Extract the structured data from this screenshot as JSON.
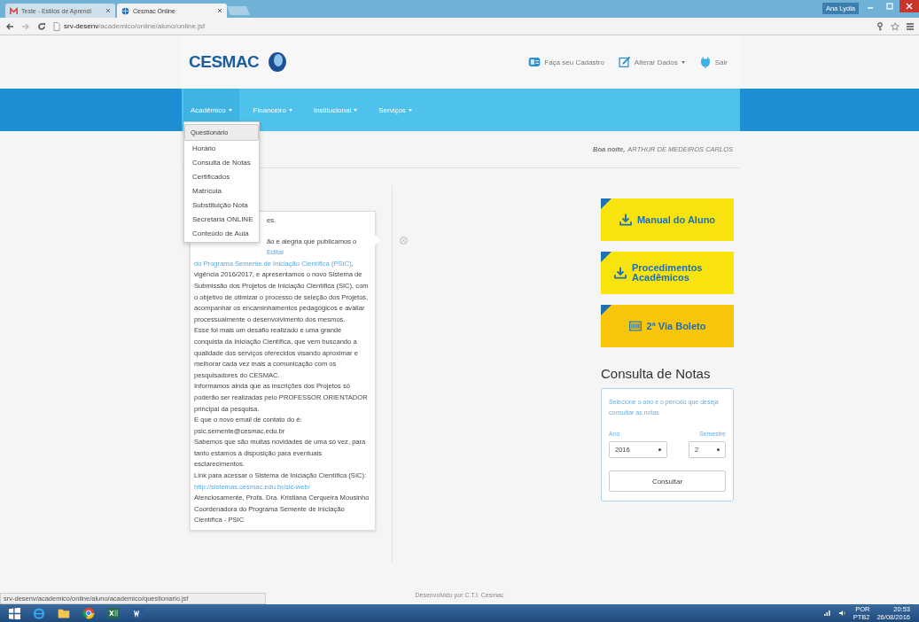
{
  "browser": {
    "tabs": [
      {
        "title": "Teste - Estilos de Aprendi",
        "kind": "mail",
        "selected": false
      },
      {
        "title": "Cesmac Online",
        "kind": "globe",
        "selected": true
      }
    ],
    "profile": "Ana Lydia",
    "address": {
      "host": "srv-desenv",
      "path": "/academico/online/aluno/online.jsf"
    }
  },
  "header": {
    "logo": "CESMAC",
    "links": [
      {
        "label": "Faça seu Cadastro",
        "kind": "register",
        "dropdown": false
      },
      {
        "label": "Alterar Dados",
        "kind": "edit",
        "dropdown": true
      },
      {
        "label": "Sair",
        "kind": "exit",
        "dropdown": false
      }
    ]
  },
  "nav": [
    {
      "label": "Acadêmico",
      "expanded": true,
      "items": [
        {
          "label": "Questionário",
          "selected": true
        },
        {
          "label": "Horário",
          "selected": false
        },
        {
          "label": "Consulta de Notas",
          "selected": false
        },
        {
          "label": "Certificados",
          "selected": false
        },
        {
          "label": "Matrícula",
          "selected": false
        },
        {
          "label": "Substituição Nota",
          "selected": false
        },
        {
          "label": "Secretaria ONLINE",
          "selected": false
        },
        {
          "label": "Conteúdo de Aula",
          "selected": false
        }
      ]
    },
    {
      "label": "Financeiro",
      "expanded": false
    },
    {
      "label": "Institucional",
      "expanded": false
    },
    {
      "label": "Serviços",
      "expanded": false
    }
  ],
  "greeting": {
    "salutation": "Boa noite,",
    "name": "ARTHUR DE MEDEIROS CARLOS"
  },
  "notice": {
    "paragraphs": [
      {
        "partial": true,
        "segments": [
          {
            "kind": "text",
            "text": "es."
          }
        ]
      },
      {
        "partial": true,
        "segments": [
          {
            "kind": "text",
            "text": "ão e alegria que publicamos o "
          },
          {
            "kind": "link",
            "text": "Edital"
          }
        ]
      },
      {
        "partial": false,
        "segments": [
          {
            "kind": "link",
            "text": "do Programa Semente de Iniciação Científica (PSIC)"
          },
          {
            "kind": "text",
            "text": ", vigência 2016/2017, e apresentamos o novo Sistema de Submissão dos Projetos de Iniciação Científica (SIC), com o objetivo de otimizar o processo de seleção dos Projetos, acompanhar os encaminhamentos pedagógicos e avaliar processualmente o desenvolvimento dos mesmos."
          }
        ]
      },
      {
        "partial": false,
        "segments": [
          {
            "kind": "text",
            "text": "Esse foi mais um desafio realizado e uma grande conquista da Iniciação Científica, que vem buscando a qualidade dos serviços oferecidos visando aproximar e melhorar cada vez mais a comunicação com os pesquisadores do CESMAC."
          }
        ]
      },
      {
        "partial": false,
        "segments": [
          {
            "kind": "text",
            "text": "Informamos ainda que as inscrições dos Projetos só poderão ser realizadas pelo PROFESSOR ORIENTADOR principal da pesquisa."
          }
        ]
      },
      {
        "partial": false,
        "segments": [
          {
            "kind": "text",
            "text": "E que o novo email de contato do é:"
          }
        ]
      },
      {
        "partial": false,
        "segments": [
          {
            "kind": "text",
            "text": "psic.semente@cesmac.edu.br"
          }
        ]
      },
      {
        "partial": false,
        "segments": [
          {
            "kind": "text",
            "text": "Sabemos que são muitas novidades de uma só vez, para tanto estamos à disposição para eventuais esclarecimentos."
          }
        ]
      },
      {
        "partial": false,
        "segments": [
          {
            "kind": "text",
            "text": "Link para acessar o Sistema de Iniciação Científica (SIC):"
          }
        ]
      },
      {
        "partial": false,
        "segments": [
          {
            "kind": "link",
            "text": "http://sistemas.cesmac.edu.br/sic-web/"
          }
        ]
      },
      {
        "partial": false,
        "segments": [
          {
            "kind": "text",
            "text": "Atenciosamente, Profa. Dra. Kristiana Cerqueira Mousinho"
          }
        ]
      },
      {
        "partial": false,
        "segments": [
          {
            "kind": "text",
            "text": "Coordenadora do Programa Semente de Iniciação Científica - PSIC"
          }
        ]
      }
    ]
  },
  "quick_links": [
    {
      "label": "Manual do Aluno",
      "kind": "download",
      "color": "#f8e40c"
    },
    {
      "label": "Procedimentos Acadêmicos",
      "kind": "download",
      "color": "#f8e40c"
    },
    {
      "label": "2ª Via Boleto",
      "kind": "barcode",
      "color": "#f8c40c"
    }
  ],
  "grades": {
    "title": "Consulta de Notas",
    "hint": "Selecione o ano e o período que deseja consultar as notas",
    "year_label": "Ano",
    "year": "2016",
    "semester_label": "Semestre",
    "semester": "2",
    "button": "Consultar"
  },
  "footer": "Desenvolvido por C.T.I. Cesmac",
  "status_url": "srv-desenv/academico/online/aluno/academico/questionario.jsf",
  "taskbar": {
    "apps": [
      {
        "kind": "browser"
      },
      {
        "kind": "folder"
      },
      {
        "kind": "chrome"
      },
      {
        "kind": "spreadsheet"
      },
      {
        "kind": "document"
      }
    ],
    "lang": "POR",
    "layout": "PTB2",
    "time": "20:53",
    "date": "26/08/2016"
  }
}
